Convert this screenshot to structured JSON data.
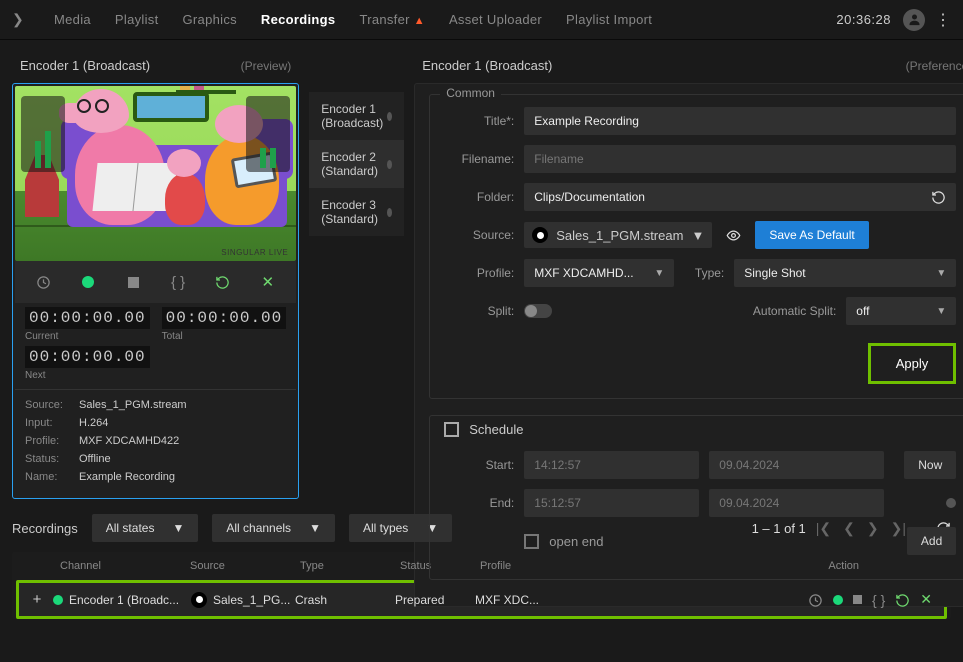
{
  "topnav": {
    "items": [
      "Media",
      "Playlist",
      "Graphics",
      "Recordings",
      "Transfer",
      "Asset Uploader",
      "Playlist Import"
    ],
    "active_index": 3,
    "alert_index": 4,
    "clock": "20:36:28"
  },
  "preview": {
    "title": "Encoder 1 (Broadcast)",
    "subtitle": "(Preview)",
    "watermark": "SINGULAR LIVE",
    "timecodes": {
      "current_label": "Current",
      "current": "00:00:00.00",
      "total_label": "Total",
      "total": "00:00:00.00",
      "next_label": "Next",
      "next": "00:00:00.00"
    },
    "meta": {
      "source_k": "Source:",
      "source_v": "Sales_1_PGM.stream",
      "input_k": "Input:",
      "input_v": "H.264",
      "profile_k": "Profile:",
      "profile_v": "MXF XDCAMHD422",
      "status_k": "Status:",
      "status_v": "Offline",
      "name_k": "Name:",
      "name_v": "Example Recording"
    }
  },
  "encoders": [
    {
      "label": "Encoder 1 (Broadcast)"
    },
    {
      "label": "Encoder 2 (Standard)"
    },
    {
      "label": "Encoder 3 (Standard)"
    }
  ],
  "prefs": {
    "title": "Encoder 1 (Broadcast)",
    "subtitle": "(Preferences)",
    "common_legend": "Common",
    "title_label": "Title*:",
    "title_value": "Example Recording",
    "filename_label": "Filename:",
    "filename_placeholder": "Filename",
    "folder_label": "Folder:",
    "folder_value": "Clips/Documentation",
    "source_label": "Source:",
    "source_value": "Sales_1_PGM.stream",
    "save_default": "Save As Default",
    "profile_label": "Profile:",
    "profile_value": "MXF XDCAMHD...",
    "type_label": "Type:",
    "type_value": "Single Shot",
    "split_label": "Split:",
    "autosplit_label": "Automatic Split:",
    "autosplit_value": "off",
    "apply": "Apply",
    "schedule_legend": "Schedule",
    "start_label": "Start:",
    "start_time": "14:12:57",
    "start_date": "09.04.2024",
    "now": "Now",
    "end_label": "End:",
    "end_time": "15:12:57",
    "end_date": "09.04.2024",
    "open_end": "open end",
    "add": "Add"
  },
  "recordings": {
    "title": "Recordings",
    "filters": {
      "states": "All states",
      "channels": "All channels",
      "types": "All types"
    },
    "pager": "1 – 1 of 1",
    "columns": {
      "channel": "Channel",
      "source": "Source",
      "type": "Type",
      "status": "Status",
      "profile": "Profile",
      "action": "Action"
    },
    "rows": [
      {
        "channel": "Encoder 1 (Broadc...",
        "source": "Sales_1_PG...",
        "type": "Crash",
        "status": "Prepared",
        "profile": "MXF XDC..."
      }
    ]
  }
}
